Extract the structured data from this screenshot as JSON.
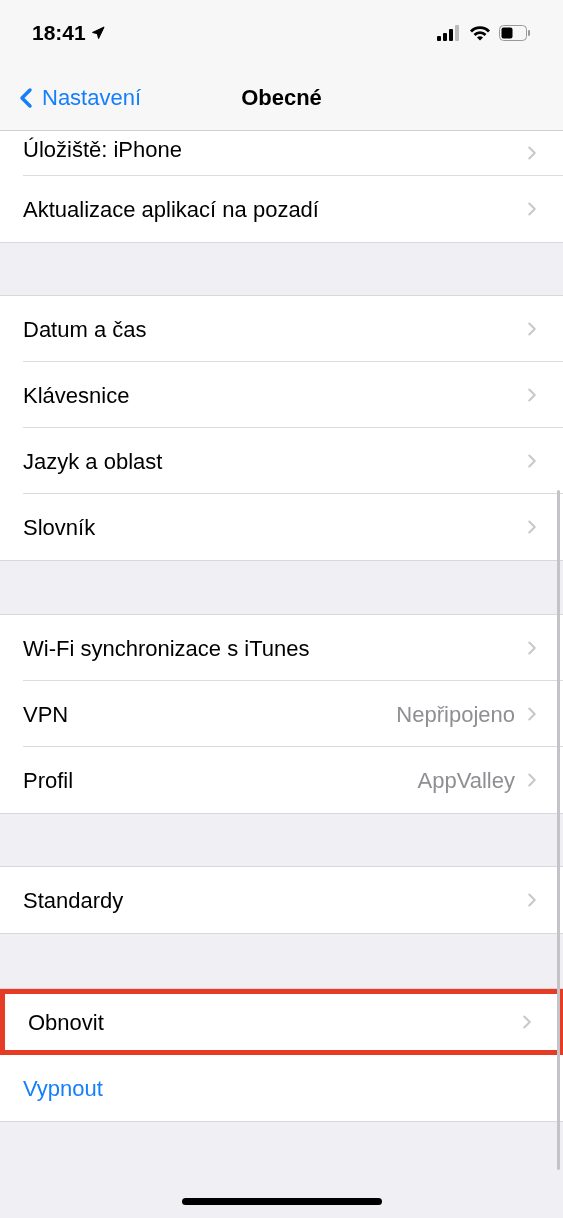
{
  "status_bar": {
    "time": "18:41"
  },
  "nav": {
    "back": "Nastavení",
    "title": "Obecné"
  },
  "groups": [
    {
      "rows": [
        {
          "label": "Úložiště: iPhone",
          "kind": "link",
          "highlighted": false,
          "partial": true
        },
        {
          "label": "Aktualizace aplikací na pozadí",
          "kind": "link",
          "highlighted": false,
          "partial": false
        }
      ]
    },
    {
      "rows": [
        {
          "label": "Datum a čas",
          "kind": "link",
          "highlighted": false,
          "partial": false
        },
        {
          "label": "Klávesnice",
          "kind": "link",
          "highlighted": false,
          "partial": false
        },
        {
          "label": "Jazyk a oblast",
          "kind": "link",
          "highlighted": false,
          "partial": false
        },
        {
          "label": "Slovník",
          "kind": "link",
          "highlighted": false,
          "partial": false
        }
      ]
    },
    {
      "rows": [
        {
          "label": "Wi-Fi synchronizace s iTunes",
          "kind": "link",
          "highlighted": false,
          "partial": false
        },
        {
          "label": "VPN",
          "value": "Nepřipojeno",
          "kind": "link",
          "highlighted": false,
          "partial": false
        },
        {
          "label": "Profil",
          "value": "AppValley",
          "kind": "link",
          "highlighted": false,
          "partial": false
        }
      ]
    },
    {
      "rows": [
        {
          "label": "Standardy",
          "kind": "link",
          "highlighted": false,
          "partial": false
        }
      ]
    },
    {
      "rows": [
        {
          "label": "Obnovit",
          "kind": "link",
          "highlighted": true,
          "partial": false
        },
        {
          "label": "Vypnout",
          "kind": "action",
          "highlighted": false,
          "partial": false
        }
      ]
    }
  ]
}
